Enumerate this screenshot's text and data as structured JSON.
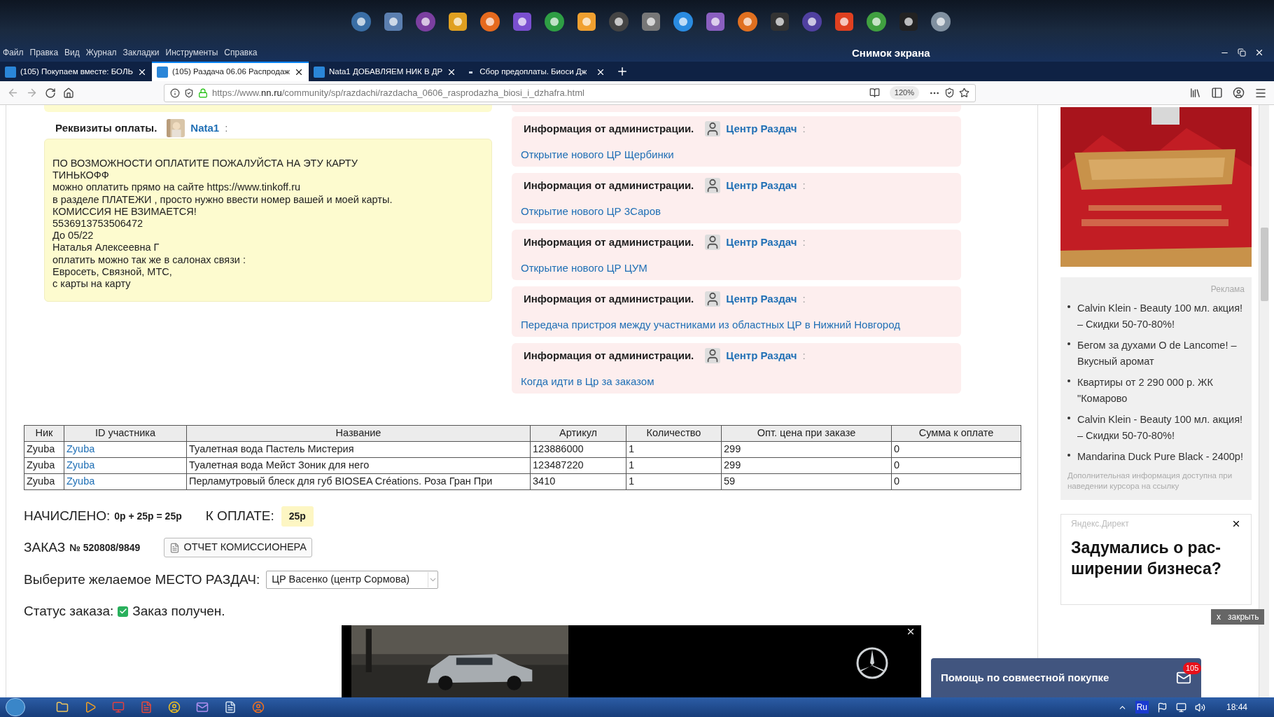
{
  "desktop": {
    "window_title": "Снимок экрана"
  },
  "menu": [
    "Файл",
    "Правка",
    "Вид",
    "Журнал",
    "Закладки",
    "Инструменты",
    "Справка"
  ],
  "tabs": [
    {
      "label": "(105) Покупаем вместе: БОЛЬ",
      "selected": false,
      "kind": "favicon"
    },
    {
      "label": "(105) Раздача 06.06 Распродаж",
      "selected": true,
      "kind": "favicon"
    },
    {
      "label": "Nata1 ДОБАВЛЯЕМ НИК В ДР",
      "selected": false,
      "kind": "favicon"
    },
    {
      "label": "Сбор предоплаты. Биоси Дж",
      "selected": false,
      "kind": "dot"
    }
  ],
  "address": {
    "prefix": "https://www.",
    "domain": "nn.ru",
    "path": "/community/sp/razdachi/razdacha_0606_rasprodazha_biosi_i_dzhafra.html",
    "zoom": "120%"
  },
  "payment": {
    "title": "Реквизиты оплаты.",
    "author": "Nata1",
    "suffix": ":",
    "lines": [
      "ПО ВОЗМОЖНОСТИ ОПЛАТИТЕ ПОЖАЛУЙСТА НА ЭТУ КАРТУ",
      "ТИНЬКОФФ",
      "можно оплатить прямо на сайте https://www.tinkoff.ru",
      "в разделе ПЛАТЕЖИ , просто нужно ввести номер вашей и моей карты.",
      "КОМИССИЯ НЕ ВЗИМАЕТСЯ!",
      "5536913753506472",
      "До 05/22",
      "Наталья Алексеевна Г",
      "оплатить можно так же в салонах связи :",
      "Евросеть, Связной, МТС,",
      "с карты на карту"
    ]
  },
  "admin_posts": [
    {
      "title": "Информация от администрации.",
      "author": "Центр Раздач",
      "suffix": ":",
      "link": "Открытие нового ЦР Щербинки"
    },
    {
      "title": "Информация от администрации.",
      "author": "Центр Раздач",
      "suffix": ":",
      "link": "Открытие нового ЦР 3Саров"
    },
    {
      "title": "Информация от администрации.",
      "author": "Центр Раздач",
      "suffix": ":",
      "link": "Открытие нового ЦР ЦУМ"
    },
    {
      "title": "Информация от администрации.",
      "author": "Центр Раздач",
      "suffix": ":",
      "link": "Передача пристроя между участниками из областных ЦР в Нижний Новгород"
    },
    {
      "title": "Информация от администрации.",
      "author": "Центр Раздач",
      "suffix": ":",
      "link": "Когда идти в Цр за заказом"
    }
  ],
  "table": {
    "columns": [
      "Ник",
      "ID участника",
      "Название",
      "Артикул",
      "Количество",
      "Опт. цена при заказе",
      "Сумма к оплате"
    ],
    "rows": [
      [
        "Zyuba",
        "Zyuba",
        "Туалетная вода Пастель Мистерия",
        "123886000",
        "1",
        "299",
        "0"
      ],
      [
        "Zyuba",
        "Zyuba",
        "Туалетная вода Мейст Зоник для него",
        "123487220",
        "1",
        "299",
        "0"
      ],
      [
        "Zyuba",
        "Zyuba",
        "Перламутровый блеск для губ BIOSEA Créations. Роза Гран При",
        "3410",
        "1",
        "59",
        "0"
      ]
    ]
  },
  "summary": {
    "accrued_label": "НАЧИСЛЕНО:",
    "accrued_value": "0р + 25р = 25р",
    "due_label": "К ОПЛАТЕ:",
    "due_value": "25р",
    "order_label": "ЗАКАЗ",
    "order_number": "№ 520808/9849",
    "report_button": "ОТЧЕТ КОМИССИОНЕРА",
    "place_label": "Выберите желаемое МЕСТО РАЗДАЧ:",
    "place_value": "ЦР Васенко (центр Сормова)",
    "status_label": "Статус заказа:",
    "status_checked": true,
    "status_value": "Заказ получен."
  },
  "ads": {
    "label": "Реклама",
    "items": [
      "Calvin Klein - Beauty 100 мл. акция! – Скидки 50-70-80%!",
      "Бегом за духами O de Lancome! – Вкусный аромат",
      "Квартиры от 2 290 000 р. ЖК \"Комарово",
      "Calvin Klein - Beauty 100 мл. акция! – Скидки 50-70-80%!",
      "Mandarina Duck Pure Black - 2400р!"
    ],
    "note": "Дополнительная информация доступна при наведении курсора на ссылку"
  },
  "direct": {
    "source": "Яндекс.Директ",
    "headline": "Задумались о рас-\nширении бизнеса?",
    "close_x": "x",
    "close_label": "закрыть"
  },
  "help_widget": {
    "title": "Помощь по совместной покупке",
    "badge": "105"
  },
  "taskbar": {
    "language": "Ru",
    "time": "18:44"
  }
}
